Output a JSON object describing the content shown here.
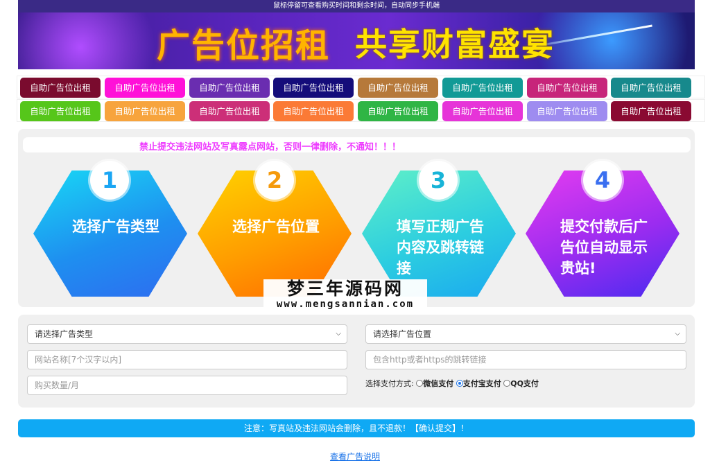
{
  "top_notice": "鼠标停留可查看购买时间和剩余时间，自动同步手机端",
  "banner": {
    "title_left": "广告位招租",
    "title_right": "共享财富盛宴"
  },
  "ad_rows": [
    [
      {
        "label": "自助广告位出租",
        "color": "#7a0b2e"
      },
      {
        "label": "自助广告位出租",
        "color": "#ff11d8"
      },
      {
        "label": "自助广告位出租",
        "color": "#6a2db0"
      },
      {
        "label": "自助广告位出租",
        "color": "#140c7a"
      },
      {
        "label": "自助广告位出租",
        "color": "#b6793a"
      },
      {
        "label": "自助广告位出租",
        "color": "#129a96"
      },
      {
        "label": "自助广告位出租",
        "color": "#c7257a"
      },
      {
        "label": "自助广告位出租",
        "color": "#17898c"
      }
    ],
    [
      {
        "label": "自助广告位出租",
        "color": "#56c61a"
      },
      {
        "label": "自助广告位出租",
        "color": "#f7a43d"
      },
      {
        "label": "自助广告位出租",
        "color": "#cc2f78"
      },
      {
        "label": "自助广告位出租",
        "color": "#fb7a36"
      },
      {
        "label": "自助广告位出租",
        "color": "#2fb545"
      },
      {
        "label": "自助广告位出租",
        "color": "#e634d8"
      },
      {
        "label": "自助广告位出租",
        "color": "#9e8cf0"
      },
      {
        "label": "自助广告位出租",
        "color": "#8a0a32"
      }
    ]
  ],
  "warning": "禁止提交违法网站及写真露点网站，否则一律删除，不通知！！！",
  "steps": [
    {
      "num": "1",
      "text": "选择广告类型",
      "num_color": "#1aa6f4"
    },
    {
      "num": "2",
      "text": "选择广告位置",
      "num_color": "#f59a0c"
    },
    {
      "num": "3",
      "text": "填写正规广告内容及跳转链接",
      "num_color": "#18b4d8"
    },
    {
      "num": "4",
      "text": "提交付款后广告位自动显示贵站!",
      "num_color": "#3a6ff0"
    }
  ],
  "watermark": {
    "cn": "梦三年源码网",
    "en": "www.mengsannian.com"
  },
  "form": {
    "ad_type_select": "请选择广告类型",
    "ad_position_select": "请选择广告位置",
    "site_name_placeholder": "网站名称[7个汉字以内]",
    "link_placeholder": "包含http或者https的跳转链接",
    "quantity_placeholder": "购买数量/月",
    "pay_label": "选择支付方式:",
    "pay_options": [
      "微信支付",
      "支付宝支付",
      "QQ支付"
    ],
    "pay_selected": 1
  },
  "submit_label": "注意：写真站及违法网站会删除，且不退款！【确认提交】！",
  "help_link": "查看广告说明"
}
